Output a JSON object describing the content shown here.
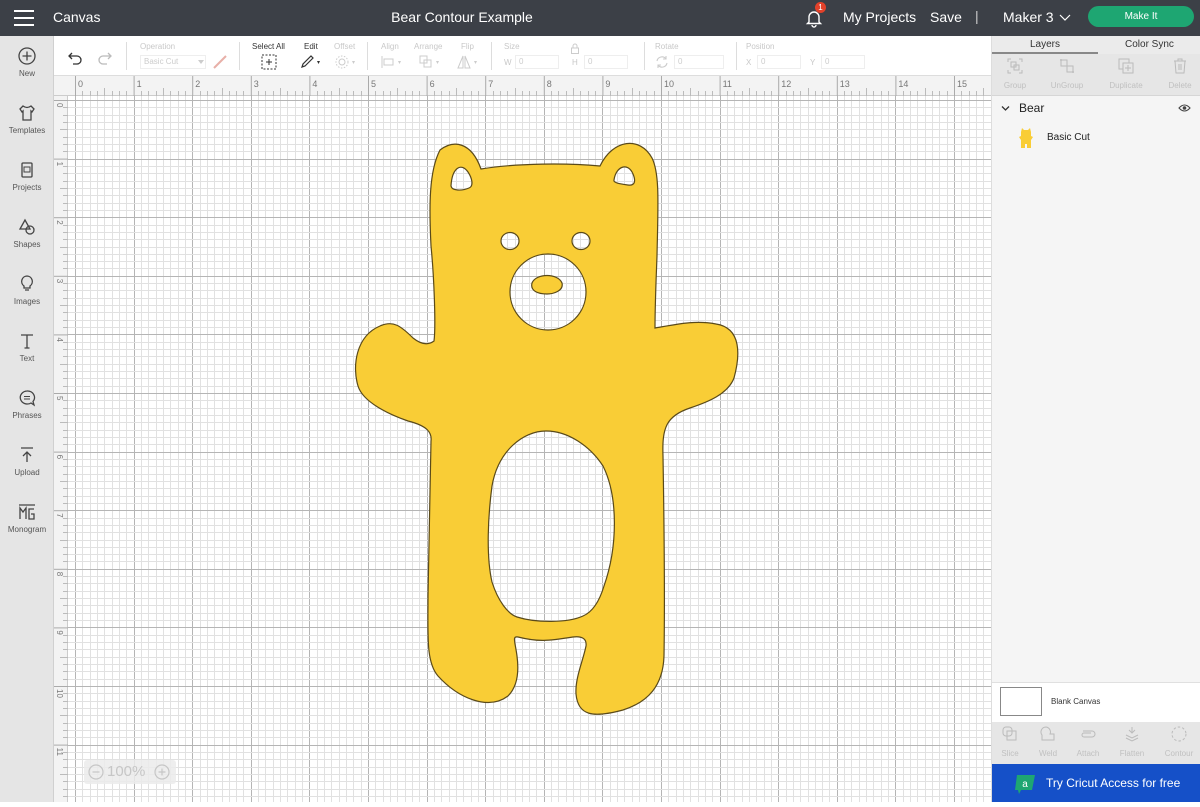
{
  "topbar": {
    "app_name": "Canvas",
    "title": "Bear Contour Example",
    "notification_count": "1",
    "my_projects": "My Projects",
    "save": "Save",
    "separator": "|",
    "machine": "Maker 3",
    "make_it": "Make It"
  },
  "leftnav": {
    "items": [
      {
        "label": "New",
        "icon": "plus-circle-icon"
      },
      {
        "label": "Templates",
        "icon": "shirt-icon"
      },
      {
        "label": "Projects",
        "icon": "projects-icon"
      },
      {
        "label": "Shapes",
        "icon": "shapes-icon"
      },
      {
        "label": "Images",
        "icon": "lightbulb-icon"
      },
      {
        "label": "Text",
        "icon": "text-icon"
      },
      {
        "label": "Phrases",
        "icon": "speech-bubble-icon"
      },
      {
        "label": "Upload",
        "icon": "upload-icon"
      },
      {
        "label": "Monogram",
        "icon": "monogram-icon"
      }
    ]
  },
  "toolbar": {
    "operation_label": "Operation",
    "operation_value": "Basic Cut",
    "select_all_label": "Select All",
    "edit_label": "Edit",
    "offset_label": "Offset",
    "align_label": "Align",
    "arrange_label": "Arrange",
    "flip_label": "Flip",
    "size_label": "Size",
    "w_label": "W",
    "w_value": "0",
    "h_label": "H",
    "h_value": "0",
    "rotate_label": "Rotate",
    "rotate_value": "0",
    "position_label": "Position",
    "x_label": "X",
    "x_value": "0",
    "y_label": "Y",
    "y_value": "0"
  },
  "rulers": {
    "horizontal": [
      "0",
      "1",
      "2",
      "3",
      "4",
      "5",
      "6",
      "7",
      "8",
      "9",
      "10",
      "11",
      "12",
      "13",
      "14",
      "15"
    ],
    "vertical": [
      "0",
      "1",
      "2",
      "3",
      "4",
      "5",
      "6",
      "7",
      "8",
      "9",
      "10",
      "11"
    ]
  },
  "canvas": {
    "shape_fill": "#f9cd36",
    "shape_stroke": "#5a4a1a",
    "zoom_level": "100%",
    "zoom_out": "−",
    "zoom_in": "+"
  },
  "rightpanel": {
    "tabs": [
      "Layers",
      "Color Sync"
    ],
    "actions": [
      "Group",
      "UnGroup",
      "Duplicate",
      "Delete"
    ],
    "layer_group_name": "Bear",
    "layer_item_name": "Basic Cut",
    "blank_canvas": "Blank Canvas",
    "bottom_actions": [
      "Slice",
      "Weld",
      "Attach",
      "Flatten",
      "Contour"
    ],
    "access_banner": "Try Cricut Access for free",
    "access_icon_letter": "a"
  }
}
